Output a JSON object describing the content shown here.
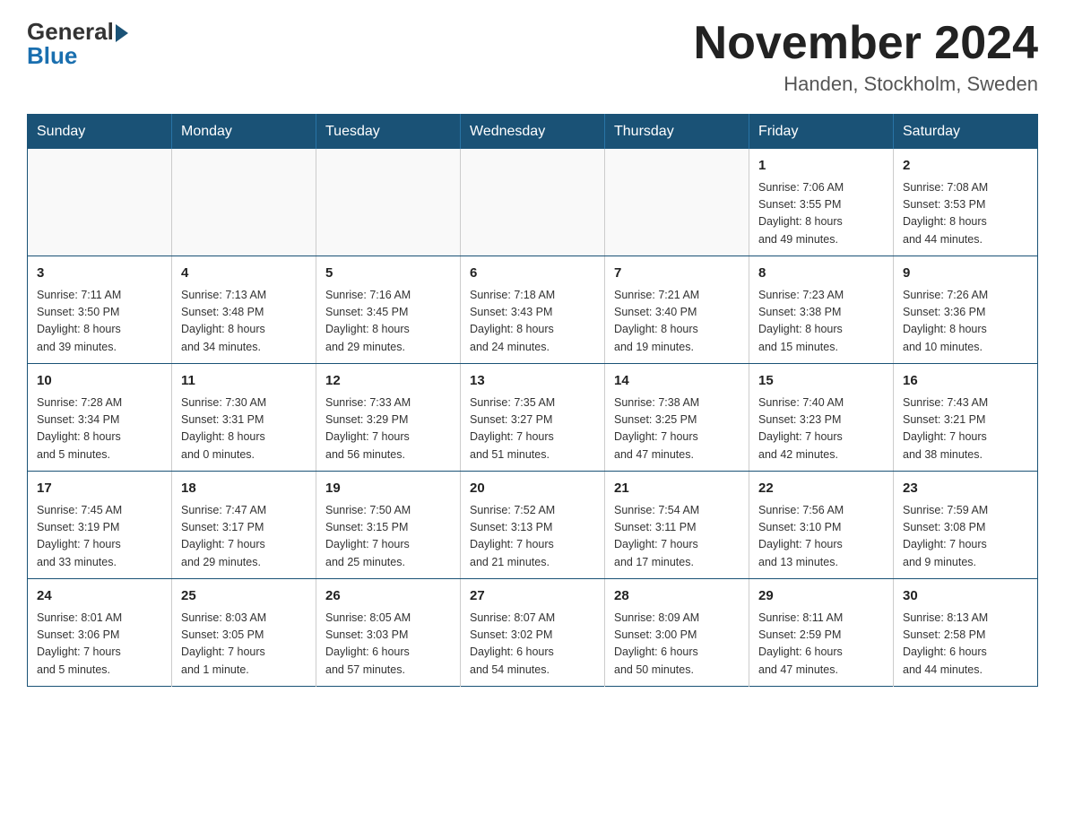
{
  "header": {
    "logo_general": "General",
    "logo_blue": "Blue",
    "month_year": "November 2024",
    "location": "Handen, Stockholm, Sweden"
  },
  "days_of_week": [
    "Sunday",
    "Monday",
    "Tuesday",
    "Wednesday",
    "Thursday",
    "Friday",
    "Saturday"
  ],
  "weeks": [
    [
      {
        "day": "",
        "info": ""
      },
      {
        "day": "",
        "info": ""
      },
      {
        "day": "",
        "info": ""
      },
      {
        "day": "",
        "info": ""
      },
      {
        "day": "",
        "info": ""
      },
      {
        "day": "1",
        "info": "Sunrise: 7:06 AM\nSunset: 3:55 PM\nDaylight: 8 hours\nand 49 minutes."
      },
      {
        "day": "2",
        "info": "Sunrise: 7:08 AM\nSunset: 3:53 PM\nDaylight: 8 hours\nand 44 minutes."
      }
    ],
    [
      {
        "day": "3",
        "info": "Sunrise: 7:11 AM\nSunset: 3:50 PM\nDaylight: 8 hours\nand 39 minutes."
      },
      {
        "day": "4",
        "info": "Sunrise: 7:13 AM\nSunset: 3:48 PM\nDaylight: 8 hours\nand 34 minutes."
      },
      {
        "day": "5",
        "info": "Sunrise: 7:16 AM\nSunset: 3:45 PM\nDaylight: 8 hours\nand 29 minutes."
      },
      {
        "day": "6",
        "info": "Sunrise: 7:18 AM\nSunset: 3:43 PM\nDaylight: 8 hours\nand 24 minutes."
      },
      {
        "day": "7",
        "info": "Sunrise: 7:21 AM\nSunset: 3:40 PM\nDaylight: 8 hours\nand 19 minutes."
      },
      {
        "day": "8",
        "info": "Sunrise: 7:23 AM\nSunset: 3:38 PM\nDaylight: 8 hours\nand 15 minutes."
      },
      {
        "day": "9",
        "info": "Sunrise: 7:26 AM\nSunset: 3:36 PM\nDaylight: 8 hours\nand 10 minutes."
      }
    ],
    [
      {
        "day": "10",
        "info": "Sunrise: 7:28 AM\nSunset: 3:34 PM\nDaylight: 8 hours\nand 5 minutes."
      },
      {
        "day": "11",
        "info": "Sunrise: 7:30 AM\nSunset: 3:31 PM\nDaylight: 8 hours\nand 0 minutes."
      },
      {
        "day": "12",
        "info": "Sunrise: 7:33 AM\nSunset: 3:29 PM\nDaylight: 7 hours\nand 56 minutes."
      },
      {
        "day": "13",
        "info": "Sunrise: 7:35 AM\nSunset: 3:27 PM\nDaylight: 7 hours\nand 51 minutes."
      },
      {
        "day": "14",
        "info": "Sunrise: 7:38 AM\nSunset: 3:25 PM\nDaylight: 7 hours\nand 47 minutes."
      },
      {
        "day": "15",
        "info": "Sunrise: 7:40 AM\nSunset: 3:23 PM\nDaylight: 7 hours\nand 42 minutes."
      },
      {
        "day": "16",
        "info": "Sunrise: 7:43 AM\nSunset: 3:21 PM\nDaylight: 7 hours\nand 38 minutes."
      }
    ],
    [
      {
        "day": "17",
        "info": "Sunrise: 7:45 AM\nSunset: 3:19 PM\nDaylight: 7 hours\nand 33 minutes."
      },
      {
        "day": "18",
        "info": "Sunrise: 7:47 AM\nSunset: 3:17 PM\nDaylight: 7 hours\nand 29 minutes."
      },
      {
        "day": "19",
        "info": "Sunrise: 7:50 AM\nSunset: 3:15 PM\nDaylight: 7 hours\nand 25 minutes."
      },
      {
        "day": "20",
        "info": "Sunrise: 7:52 AM\nSunset: 3:13 PM\nDaylight: 7 hours\nand 21 minutes."
      },
      {
        "day": "21",
        "info": "Sunrise: 7:54 AM\nSunset: 3:11 PM\nDaylight: 7 hours\nand 17 minutes."
      },
      {
        "day": "22",
        "info": "Sunrise: 7:56 AM\nSunset: 3:10 PM\nDaylight: 7 hours\nand 13 minutes."
      },
      {
        "day": "23",
        "info": "Sunrise: 7:59 AM\nSunset: 3:08 PM\nDaylight: 7 hours\nand 9 minutes."
      }
    ],
    [
      {
        "day": "24",
        "info": "Sunrise: 8:01 AM\nSunset: 3:06 PM\nDaylight: 7 hours\nand 5 minutes."
      },
      {
        "day": "25",
        "info": "Sunrise: 8:03 AM\nSunset: 3:05 PM\nDaylight: 7 hours\nand 1 minute."
      },
      {
        "day": "26",
        "info": "Sunrise: 8:05 AM\nSunset: 3:03 PM\nDaylight: 6 hours\nand 57 minutes."
      },
      {
        "day": "27",
        "info": "Sunrise: 8:07 AM\nSunset: 3:02 PM\nDaylight: 6 hours\nand 54 minutes."
      },
      {
        "day": "28",
        "info": "Sunrise: 8:09 AM\nSunset: 3:00 PM\nDaylight: 6 hours\nand 50 minutes."
      },
      {
        "day": "29",
        "info": "Sunrise: 8:11 AM\nSunset: 2:59 PM\nDaylight: 6 hours\nand 47 minutes."
      },
      {
        "day": "30",
        "info": "Sunrise: 8:13 AM\nSunset: 2:58 PM\nDaylight: 6 hours\nand 44 minutes."
      }
    ]
  ]
}
